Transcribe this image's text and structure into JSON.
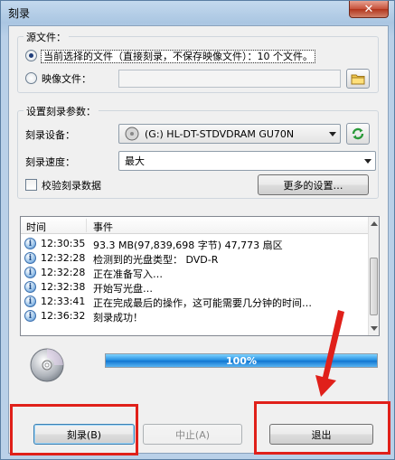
{
  "window": {
    "title": "刻录",
    "close_glyph": "✕"
  },
  "source": {
    "group_title": "源文件：",
    "option_current": "当前选择的文件（直接刻录，不保存映像文件）：10 个文件。",
    "option_image": "映像文件：",
    "image_path": "",
    "browse_icon": "folder-icon"
  },
  "settings": {
    "group_title": "设置刻录参数：",
    "device_label": "刻录设备：",
    "device_value": "(G:) HL-DT-STDVDRAM GU70N",
    "refresh_icon": "refresh-icon",
    "speed_label": "刻录速度：",
    "speed_value": "最大",
    "verify_label": "校验刻录数据",
    "more_settings": "更多的设置…"
  },
  "log": {
    "columns": [
      "时间",
      "事件"
    ],
    "rows": [
      {
        "time": "12:30:35",
        "event": "93.3 MB(97,839,698 字节)  47,773 扇区"
      },
      {
        "time": "12:32:28",
        "event": "检测到的光盘类型：  DVD-R"
      },
      {
        "time": "12:32:28",
        "event": "正在准备写入…"
      },
      {
        "time": "12:32:38",
        "event": "开始写光盘…"
      },
      {
        "time": "12:33:41",
        "event": "正在完成最后的操作，这可能需要几分钟的时间…"
      },
      {
        "time": "12:36:32",
        "event": "刻录成功！"
      }
    ]
  },
  "progress": {
    "value": 100,
    "text": "100%",
    "color": "#1f8be0"
  },
  "buttons": {
    "burn": "刻录(B)",
    "abort": "中止(A)",
    "exit": "退出"
  },
  "colors": {
    "highlight_box": "#e0201a"
  }
}
